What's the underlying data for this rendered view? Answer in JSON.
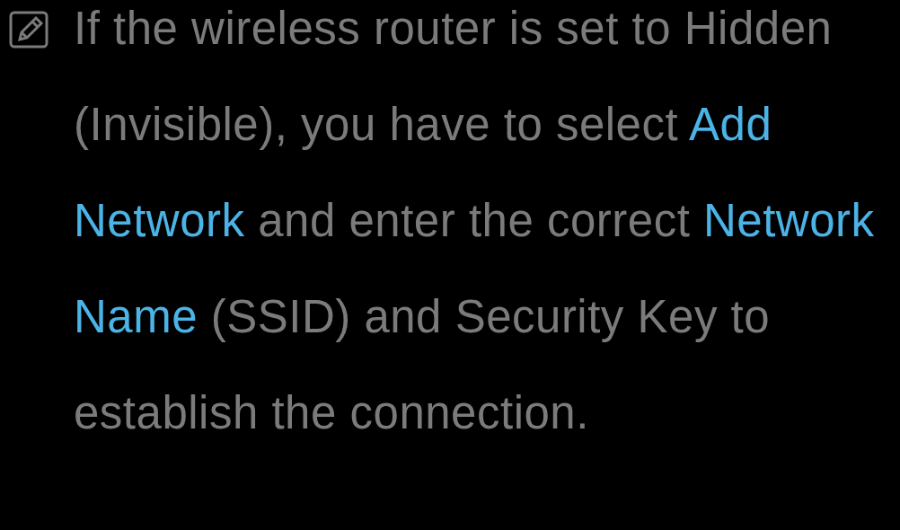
{
  "note": {
    "segments": [
      {
        "kind": "plain",
        "text": "If the wireless router is set to Hidden (Invisible), you have to select "
      },
      {
        "kind": "term",
        "text": "Add Network"
      },
      {
        "kind": "plain",
        "text": " and enter the correct "
      },
      {
        "kind": "term",
        "text": "Network Name"
      },
      {
        "kind": "plain",
        "text": " (SSID) and Security Key to establish the connection."
      }
    ]
  }
}
